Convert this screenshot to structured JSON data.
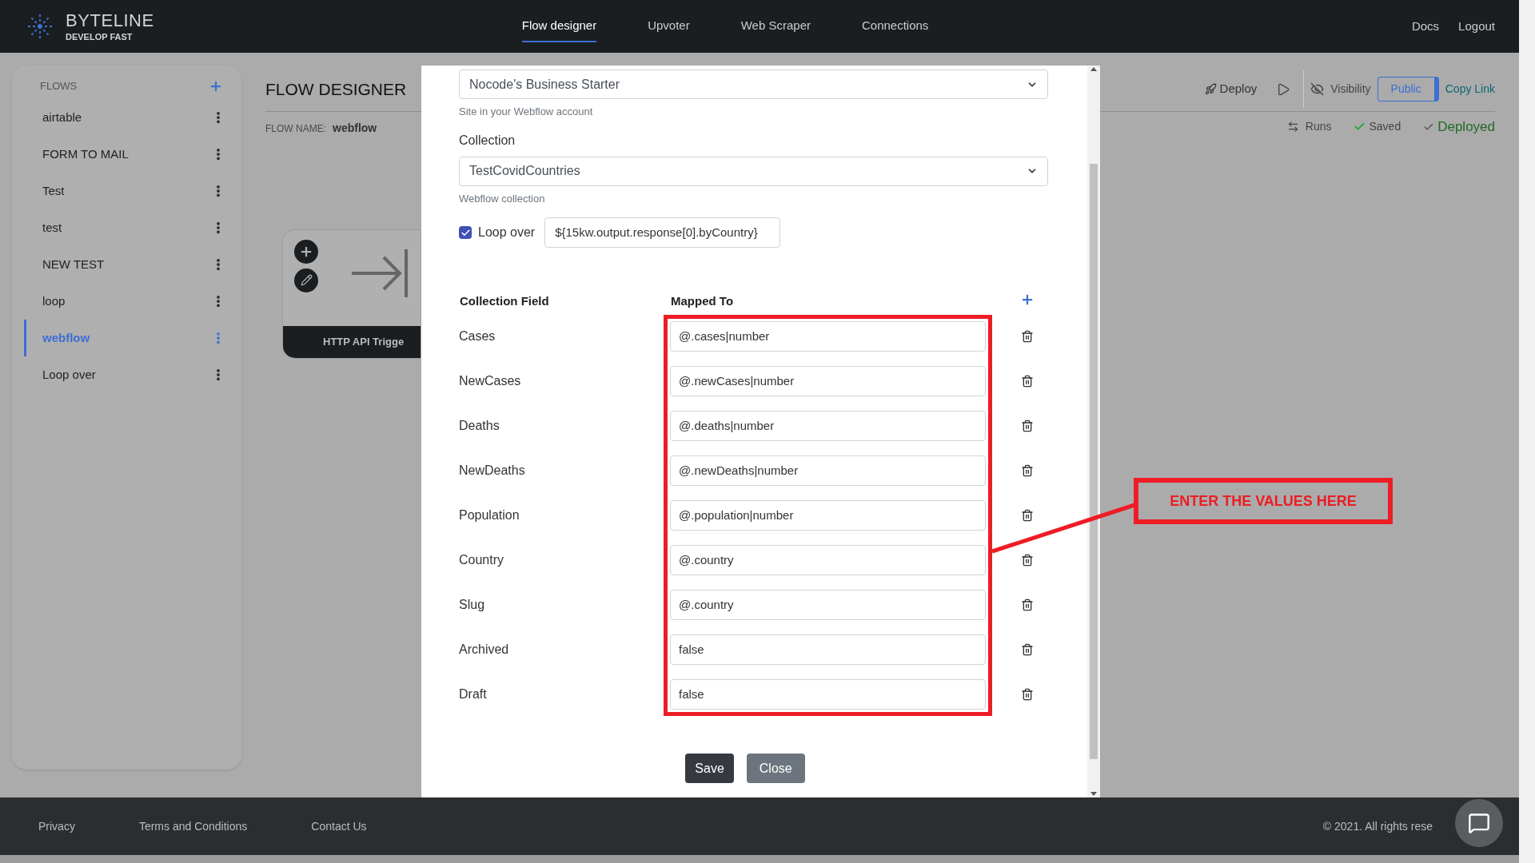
{
  "nav": {
    "brand": "BYTELINE",
    "tagline": "DEVELOP FAST",
    "links": [
      {
        "label": "Flow designer",
        "selected": true
      },
      {
        "label": "Upvoter",
        "selected": false
      },
      {
        "label": "Web Scraper",
        "selected": false
      },
      {
        "label": "Connections",
        "selected": false
      }
    ],
    "right_links": [
      "Docs",
      "Logout"
    ]
  },
  "sidebar": {
    "title": "FLOWS",
    "items": [
      {
        "label": "airtable",
        "selected": false
      },
      {
        "label": "FORM TO MAIL",
        "selected": false
      },
      {
        "label": "Test",
        "selected": false
      },
      {
        "label": "test",
        "selected": false
      },
      {
        "label": "NEW TEST",
        "selected": false
      },
      {
        "label": "loop",
        "selected": false
      },
      {
        "label": "webflow",
        "selected": true
      },
      {
        "label": "Loop over",
        "selected": false
      }
    ]
  },
  "header": {
    "title": "FLOW DESIGNER",
    "flow_name_label": "FLOW NAME:",
    "flow_name": "webflow",
    "deploy": "Deploy",
    "visibility": "Visibility",
    "public": "Public",
    "copy_link": "Copy Link",
    "runs": "Runs",
    "saved": "Saved",
    "deployed": "Deployed"
  },
  "node": {
    "label": "HTTP API Trigge"
  },
  "modal": {
    "site": {
      "value": "Nocode's Business Starter",
      "hint": "Site in your Webflow account"
    },
    "collection": {
      "label": "Collection",
      "value": "TestCovidCountries",
      "hint": "Webflow collection"
    },
    "loop": {
      "label": "Loop over",
      "checked": true,
      "value": "${15kw.output.response[0].byCountry}"
    },
    "mapping": {
      "columns": [
        "Collection Field",
        "Mapped To"
      ],
      "rows": [
        {
          "field": "Cases",
          "value": "@.cases|number"
        },
        {
          "field": "NewCases",
          "value": "@.newCases|number"
        },
        {
          "field": "Deaths",
          "value": "@.deaths|number"
        },
        {
          "field": "NewDeaths",
          "value": "@.newDeaths|number"
        },
        {
          "field": "Population",
          "value": "@.population|number"
        },
        {
          "field": "Country",
          "value": "@.country"
        },
        {
          "field": "Slug",
          "value": "@.country"
        },
        {
          "field": "Archived",
          "value": "false"
        },
        {
          "field": "Draft",
          "value": "false"
        }
      ]
    },
    "buttons": [
      "Save",
      "Close"
    ]
  },
  "annotation": {
    "text": "ENTER THE VALUES HERE"
  },
  "footer": {
    "links": [
      "Privacy",
      "Terms and Conditions",
      "Contact Us"
    ],
    "copyright": "© 2021. All rights rese"
  }
}
